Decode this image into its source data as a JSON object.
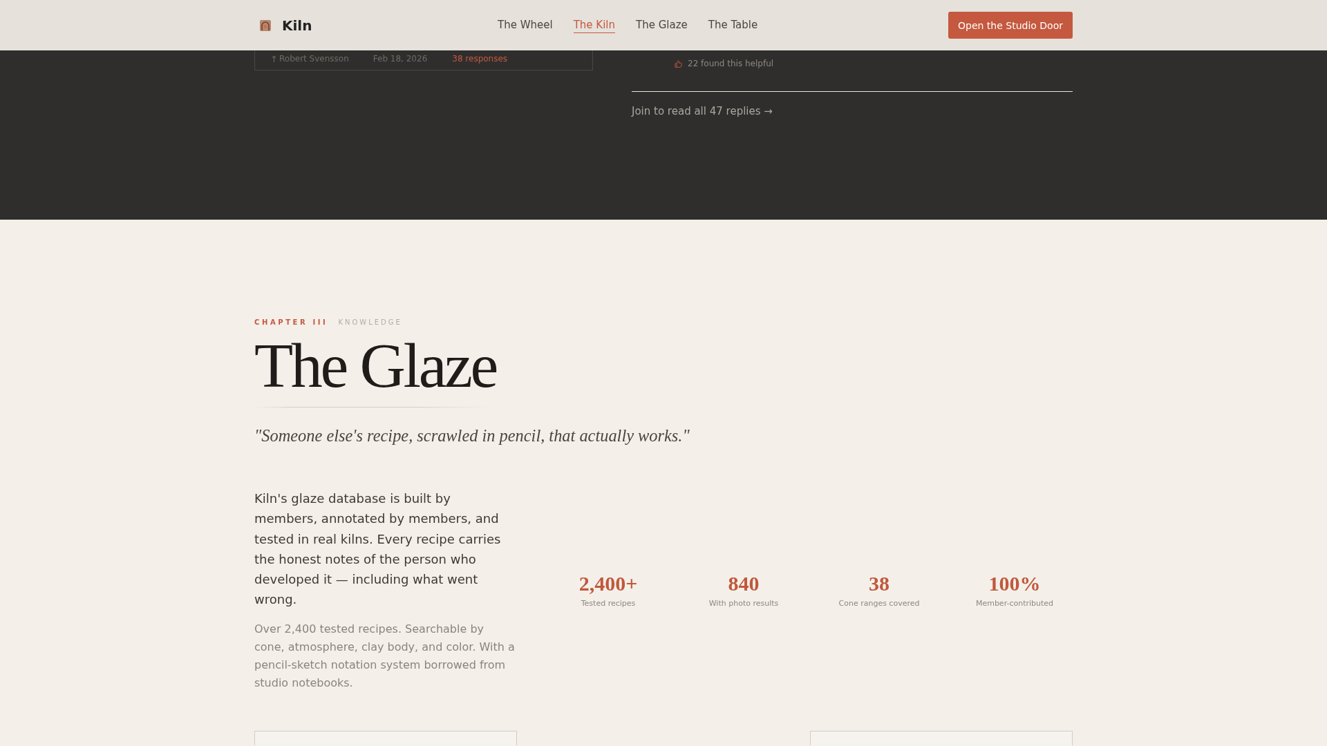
{
  "header": {
    "brand": "Kiln",
    "nav": [
      {
        "label": "The Wheel",
        "selected": false
      },
      {
        "label": "The Kiln",
        "selected": true
      },
      {
        "label": "The Glaze",
        "selected": false
      },
      {
        "label": "The Table",
        "selected": false
      }
    ],
    "cta": "Open the Studio Door"
  },
  "discussion": {
    "post_meta": {
      "author": "Robert Svensson",
      "date": "Feb 18, 2026",
      "responses": "38 responses"
    },
    "reply": {
      "helpful": "22 found this helpful"
    },
    "more_link": "Join to read all 47 replies →"
  },
  "chapter": {
    "eyebrow": "CHAPTER III",
    "category": "KNOWLEDGE",
    "title": "The Glaze",
    "quote": "\"Someone else's recipe, scrawled in pencil, that actually works.\"",
    "intro": "Kiln's glaze database is built by members, annotated by members, and tested in real kilns. Every recipe carries the honest notes of the person who developed it — including what went wrong.",
    "detail": "Over 2,400 tested recipes. Searchable by cone, atmosphere, clay body, and color. With a pencil-sketch notation system borrowed from studio notebooks.",
    "stats": [
      {
        "value": "2,400+",
        "label": "Tested recipes"
      },
      {
        "value": "840",
        "label": "With photo results"
      },
      {
        "value": "38",
        "label": "Cone ranges covered"
      },
      {
        "value": "100%",
        "label": "Member-contributed"
      }
    ]
  }
}
